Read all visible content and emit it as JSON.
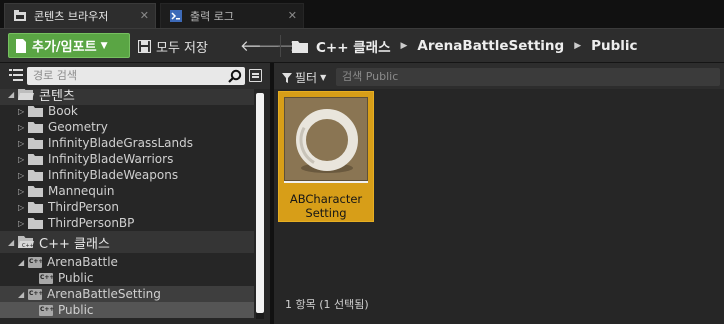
{
  "tabs": [
    {
      "label": "콘텐츠 브라우저",
      "icon": "content-browser-icon",
      "active": true
    },
    {
      "label": "출력 로그",
      "icon": "output-log-icon",
      "active": false
    }
  ],
  "toolbar": {
    "add_import_label": "추가/임포트",
    "save_all_label": "모두 저장",
    "breadcrumb": [
      "C++ 클래스",
      "ArenaBattleSetting",
      "Public"
    ]
  },
  "left_panel": {
    "search_placeholder": "경로 검색",
    "content_root": "콘텐츠",
    "folders": [
      "Book",
      "Geometry",
      "InfinityBladeGrassLands",
      "InfinityBladeWarriors",
      "InfinityBladeWeapons",
      "Mannequin",
      "ThirdPerson",
      "ThirdPersonBP"
    ],
    "cpp_root": "C++ 클래스",
    "modules": [
      {
        "name": "ArenaBattle",
        "child": "Public"
      },
      {
        "name": "ArenaBattleSetting",
        "child": "Public"
      }
    ]
  },
  "right_panel": {
    "filter_label": "필터",
    "search_placeholder": "검색 Public",
    "asset": {
      "name": "ABCharacter Setting"
    },
    "status": "1 항목 (1 선택됨)"
  },
  "colors": {
    "add_button": "#5aa544",
    "selected_tile": "#d79e18",
    "panel_bg": "#262626",
    "toolbar_bg": "#2d2d2d"
  }
}
